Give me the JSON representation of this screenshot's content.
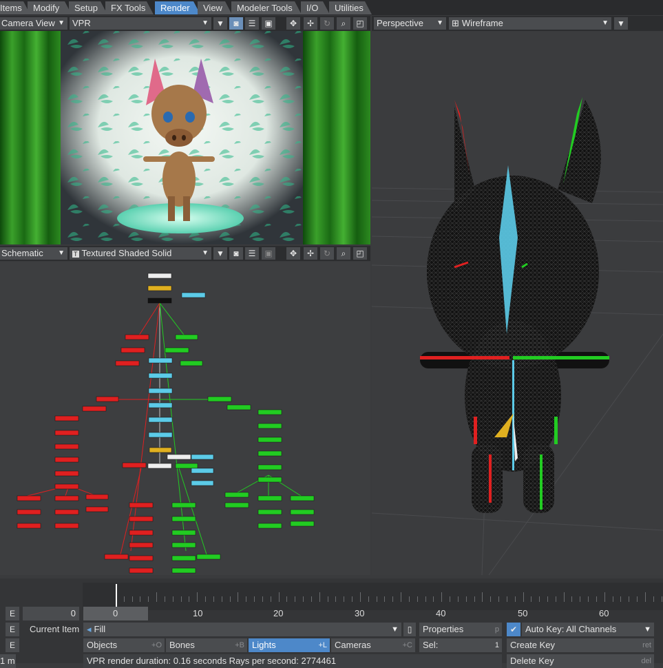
{
  "tabs": [
    {
      "label": "Items",
      "active": false
    },
    {
      "label": "Modify",
      "active": false
    },
    {
      "label": "Setup",
      "active": false
    },
    {
      "label": "FX Tools",
      "active": false
    },
    {
      "label": "Render",
      "active": true
    },
    {
      "label": "View",
      "active": false
    },
    {
      "label": "Modeler Tools",
      "active": false
    },
    {
      "label": "I/O",
      "active": false
    },
    {
      "label": "Utilities",
      "active": false
    }
  ],
  "viewport_top_left": {
    "view": "Camera View",
    "mode": "VPR"
  },
  "viewport_bottom_left": {
    "view": "Schematic",
    "mode": "Textured Shaded Solid"
  },
  "viewport_right": {
    "view": "Perspective",
    "mode": "Wireframe"
  },
  "timeline": {
    "current_frame": "0",
    "ticks": [
      "0",
      "10",
      "20",
      "30",
      "40",
      "50",
      "60"
    ],
    "current_item_label": "Current Item",
    "current_item_value": "Fill",
    "properties_label": "Properties",
    "properties_shortcut": "p",
    "auto_key_label": "Auto Key: All Channels",
    "objects_label": "Objects",
    "objects_shortcut": "+O",
    "bones_label": "Bones",
    "bones_shortcut": "+B",
    "lights_label": "Lights",
    "lights_shortcut": "+L",
    "cameras_label": "Cameras",
    "cameras_shortcut": "+C",
    "sel_label": "Sel:",
    "sel_value": "1",
    "create_key_label": "Create Key",
    "create_key_shortcut": "ret",
    "delete_key_label": "Delete Key",
    "delete_key_shortcut": "del",
    "status_text": "VPR render duration: 0.16 seconds  Rays per second: 2774461",
    "unit_label": "1 m",
    "e_label": "E"
  },
  "colors": {
    "accent": "#4d88c9",
    "bone_red": "#e02020",
    "bone_green": "#22cc22",
    "bone_cyan": "#5ccbe8",
    "bone_yellow": "#e0b020"
  },
  "icons": [
    "camera-icon",
    "list-icon",
    "save-icon",
    "move-icon",
    "rotate-icon",
    "zoom-icon",
    "maximize-icon",
    "checkbox-icon"
  ]
}
